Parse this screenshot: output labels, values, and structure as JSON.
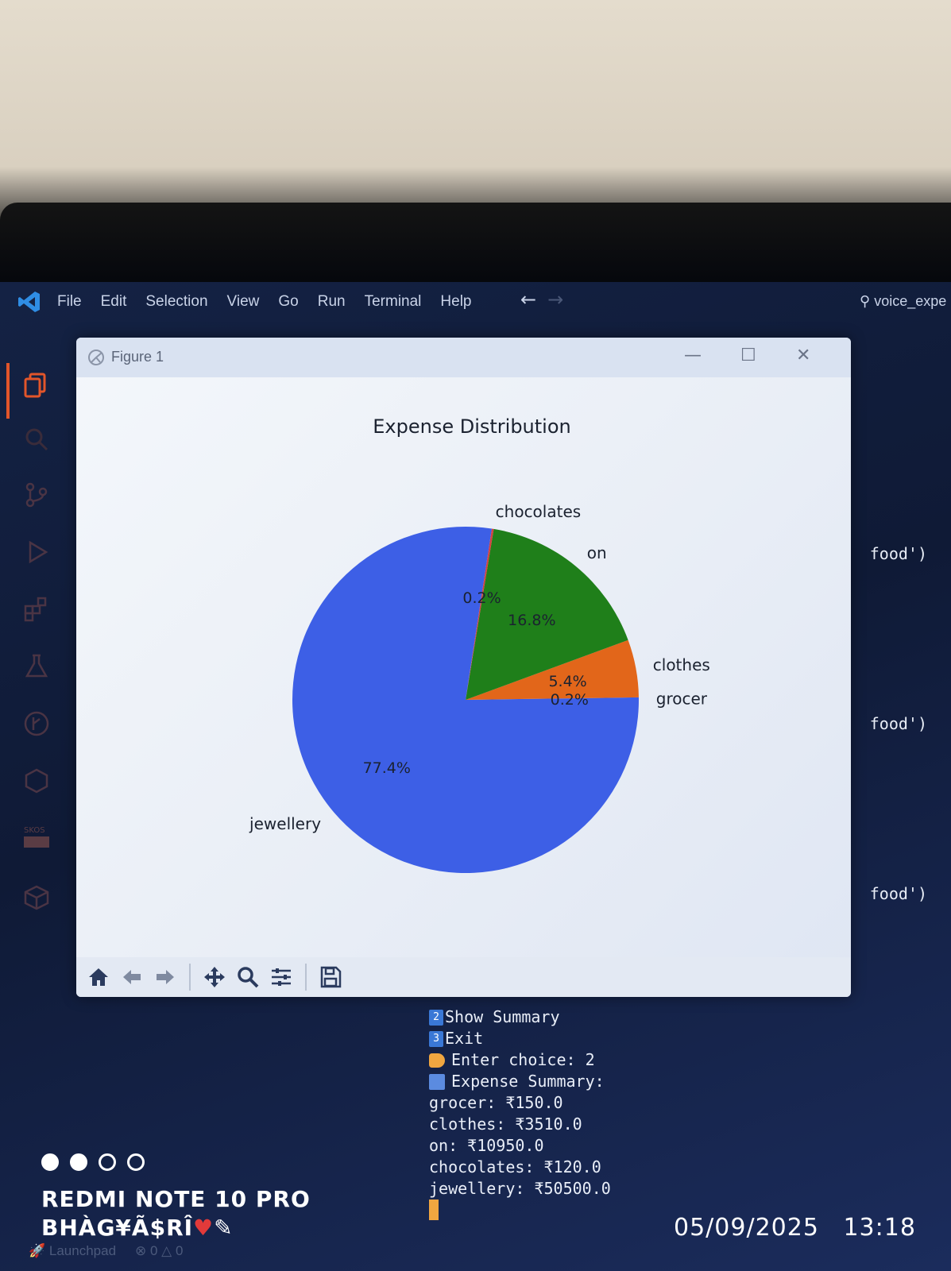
{
  "menubar": {
    "items": [
      "File",
      "Edit",
      "Selection",
      "View",
      "Go",
      "Run",
      "Terminal",
      "Help"
    ],
    "search_text": "voice_expe"
  },
  "figure": {
    "title": "Figure 1"
  },
  "chart_data": {
    "type": "pie",
    "title": "Expense Distribution",
    "labels": [
      "grocer",
      "clothes",
      "on",
      "chocolates",
      "jewellery"
    ],
    "values": [
      150.0,
      3510.0,
      10950.0,
      120.0,
      50500.0
    ],
    "percent_labels": [
      "0.2%",
      "5.4%",
      "16.8%",
      "0.2%",
      "77.4%"
    ],
    "colors": [
      "#3b5ee8",
      "#e2661a",
      "#1f7f1a",
      "#d64040",
      "#3d5fe6"
    ],
    "start_angle": 0,
    "legend": "none"
  },
  "terminal_side": [
    "food')",
    "food')",
    "food')"
  ],
  "terminal": {
    "menu_option_2_num": "2",
    "menu_option_2": "Show Summary",
    "menu_option_3_num": "3",
    "menu_option_3": "Exit",
    "prompt": "Enter choice: 2",
    "summary_header": "Expense Summary:",
    "summary_lines": [
      "grocer: ₹150.0",
      "clothes: ₹3510.0",
      "on: ₹10950.0",
      "chocolates: ₹120.0",
      "jewellery: ₹50500.0"
    ]
  },
  "statusbar": {
    "launchpad": "Launchpad",
    "problems": "0 △ 0"
  },
  "camera_watermark": {
    "device": "REDMI NOTE 10 PRO",
    "owner": "BHÀG¥Ã$RÎ",
    "date": "05/09/2025",
    "time": "13:18"
  }
}
